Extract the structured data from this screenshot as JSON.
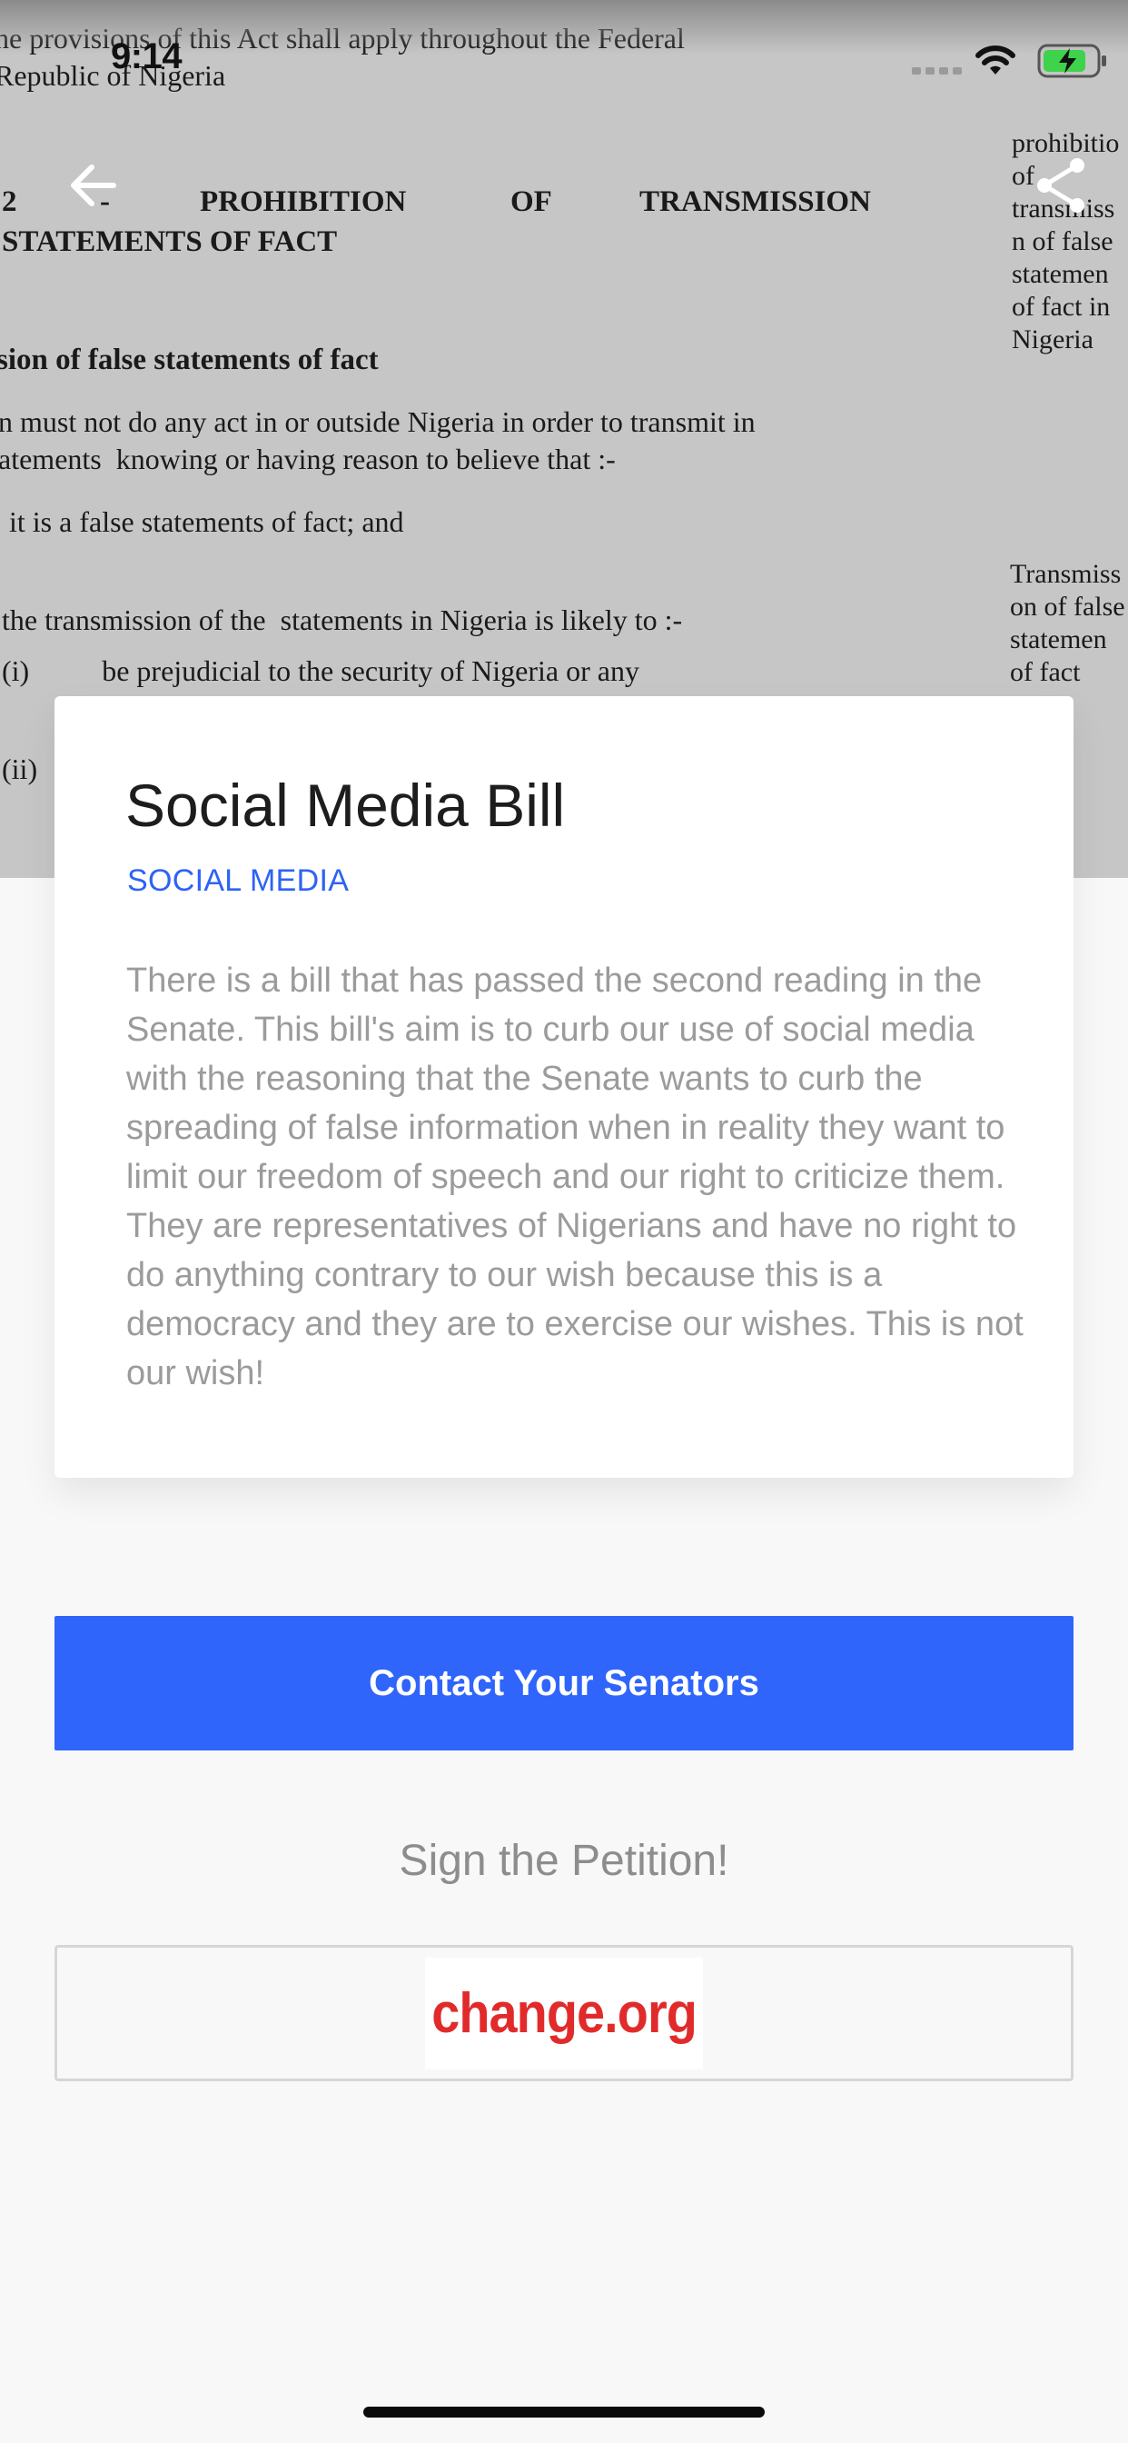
{
  "status_bar": {
    "time": "9:14"
  },
  "hero": {
    "document_lines": {
      "top": "he provisions of this Act shall apply throughout the Federal\nRepublic of Nigeria",
      "heading_number": "2",
      "heading_dash": "-",
      "heading_w1": "PROHIBITION",
      "heading_w2": "OF",
      "heading_w3": "TRANSMISSION",
      "heading_line2": "STATEMENTS OF FACT",
      "section_title": "sion of false statements of fact",
      "para1": "n must not do any act in or outside Nigeria in order to transmit in\natements  knowing or having reason to believe that :-",
      "para2": " it is a false statements of fact; and",
      "para3": "the transmission of the  statements in Nigeria is likely to :-",
      "para4": "(i)          be prejudicial to the security of Nigeria or any",
      "para5": "(ii)",
      "margin1": "prohibitio\nof\ntransmiss\nn of false\nstatemen\nof fact in\nNigeria",
      "margin2": "Transmiss\non of false\nstatemen\nof fact"
    },
    "back_icon": "arrow-left-icon",
    "share_icon": "share-icon"
  },
  "card": {
    "title": "Social Media Bill",
    "category": "SOCIAL MEDIA",
    "body": "There is a bill that has passed the second reading in the Senate. This bill's aim is to curb our use of social media with the reasoning that the Senate wants to curb the spreading of false information when in reality they want to limit our freedom of speech and our right to criticize them. They are representatives of Nigerians and have no right to do anything contrary to our wish because this is a democracy and they are to exercise our wishes. This is not our wish!"
  },
  "actions": {
    "contact_label": "Contact Your Senators",
    "petition_label": "Sign the Petition!",
    "petition_logo": "change.org"
  },
  "colors": {
    "accent": "#2f65fb",
    "category": "#2d63f5",
    "logo": "#e12b2b"
  }
}
